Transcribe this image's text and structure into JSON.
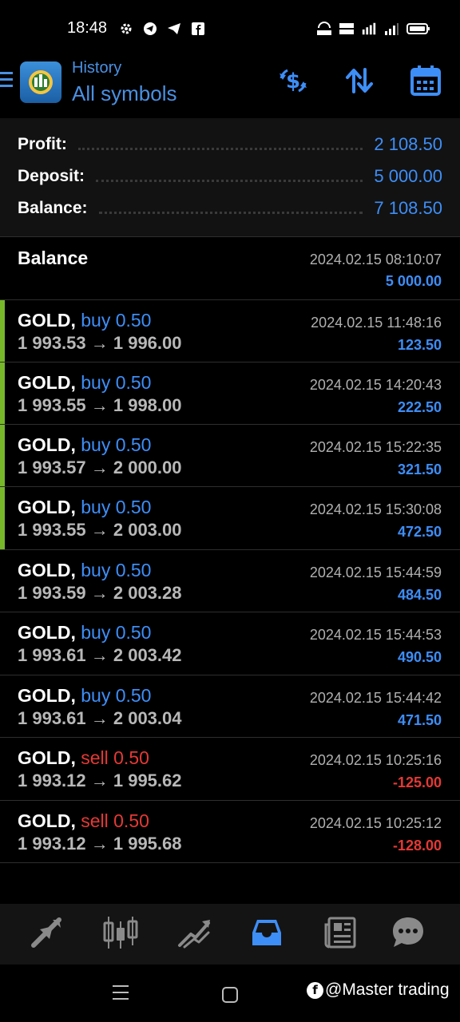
{
  "status_bar": {
    "time": "18:48"
  },
  "header": {
    "subtitle": "History",
    "title": "All symbols"
  },
  "summary": [
    {
      "label": "Profit:",
      "value": "2 108.50"
    },
    {
      "label": "Deposit:",
      "value": "5 000.00"
    },
    {
      "label": "Balance:",
      "value": "7 108.50"
    }
  ],
  "balance_entry": {
    "title": "Balance",
    "datetime": "2024.02.15 08:10:07",
    "amount": "5 000.00"
  },
  "trades": [
    {
      "symbol": "GOLD,",
      "side": "buy 0.50",
      "prices": "1 993.53 → 1 996.00",
      "datetime": "2024.02.15 11:48:16",
      "profit": "123.50"
    },
    {
      "symbol": "GOLD,",
      "side": "buy 0.50",
      "prices": "1 993.55 → 1 998.00",
      "datetime": "2024.02.15 14:20:43",
      "profit": "222.50"
    },
    {
      "symbol": "GOLD,",
      "side": "buy 0.50",
      "prices": "1 993.57 → 2 000.00",
      "datetime": "2024.02.15 15:22:35",
      "profit": "321.50"
    },
    {
      "symbol": "GOLD,",
      "side": "buy 0.50",
      "prices": "1 993.55 → 2 003.00",
      "datetime": "2024.02.15 15:30:08",
      "profit": "472.50"
    },
    {
      "symbol": "GOLD,",
      "side": "buy 0.50",
      "prices": "1 993.59 → 2 003.28",
      "datetime": "2024.02.15 15:44:59",
      "profit": "484.50"
    },
    {
      "symbol": "GOLD,",
      "side": "buy 0.50",
      "prices": "1 993.61 → 2 003.42",
      "datetime": "2024.02.15 15:44:53",
      "profit": "490.50"
    },
    {
      "symbol": "GOLD,",
      "side": "buy 0.50",
      "prices": "1 993.61 → 2 003.04",
      "datetime": "2024.02.15 15:44:42",
      "profit": "471.50"
    },
    {
      "symbol": "GOLD,",
      "side": "sell 0.50",
      "prices": "1 993.12 → 1 995.62",
      "datetime": "2024.02.15 10:25:16",
      "profit": "-125.00"
    },
    {
      "symbol": "GOLD,",
      "side": "sell 0.50",
      "prices": "1 993.12 → 1 995.68",
      "datetime": "2024.02.15 10:25:12",
      "profit": "-128.00"
    }
  ],
  "watermark": "@Master trading",
  "colors": {
    "accent_blue": "#3e8ef7",
    "loss_red": "#e53935",
    "profit_green_bar": "#76b82a"
  },
  "icons": [
    "menu-icon",
    "app-logo",
    "currency-exchange-icon",
    "sort-icon",
    "calendar-icon",
    "quotes-icon",
    "charts-icon",
    "trade-icon",
    "history-icon",
    "news-icon",
    "chat-icon"
  ]
}
